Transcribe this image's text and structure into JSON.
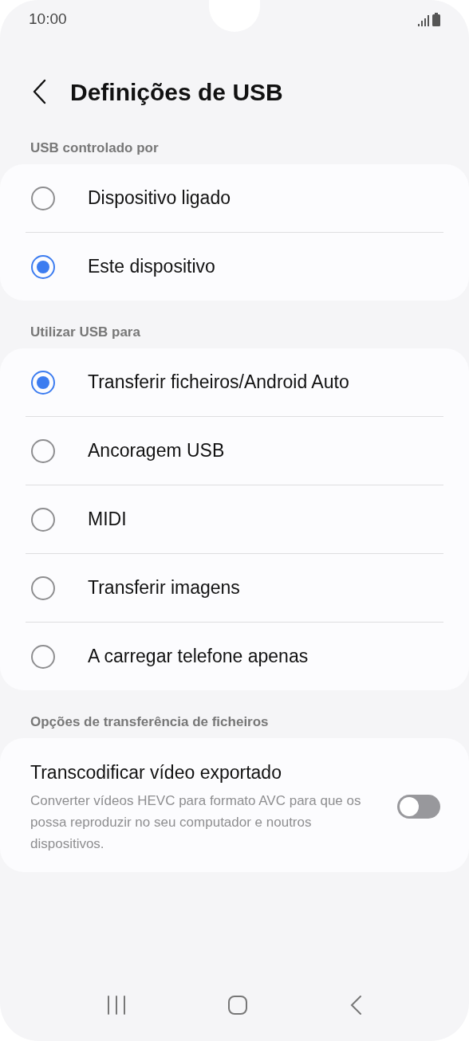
{
  "status_bar": {
    "time": "10:00"
  },
  "header": {
    "title": "Definições de USB"
  },
  "sections": [
    {
      "header": "USB controlado por",
      "items": [
        {
          "kind": "radio",
          "label": "Dispositivo ligado",
          "selected": false
        },
        {
          "kind": "radio",
          "label": "Este dispositivo",
          "selected": true
        }
      ]
    },
    {
      "header": "Utilizar USB para",
      "items": [
        {
          "kind": "radio",
          "label": "Transferir ficheiros/Android Auto",
          "selected": true
        },
        {
          "kind": "radio",
          "label": "Ancoragem USB",
          "selected": false
        },
        {
          "kind": "radio",
          "label": "MIDI",
          "selected": false
        },
        {
          "kind": "radio",
          "label": "Transferir imagens",
          "selected": false
        },
        {
          "kind": "radio",
          "label": "A carregar telefone apenas",
          "selected": false
        }
      ]
    },
    {
      "header": "Opções de transferência de ficheiros",
      "items": [
        {
          "kind": "switch",
          "label": "Transcodificar vídeo exportado",
          "description": "Converter vídeos HEVC para formato AVC para que os possa reproduzir no seu computador e noutros dispositivos.",
          "on": false
        }
      ]
    }
  ]
}
